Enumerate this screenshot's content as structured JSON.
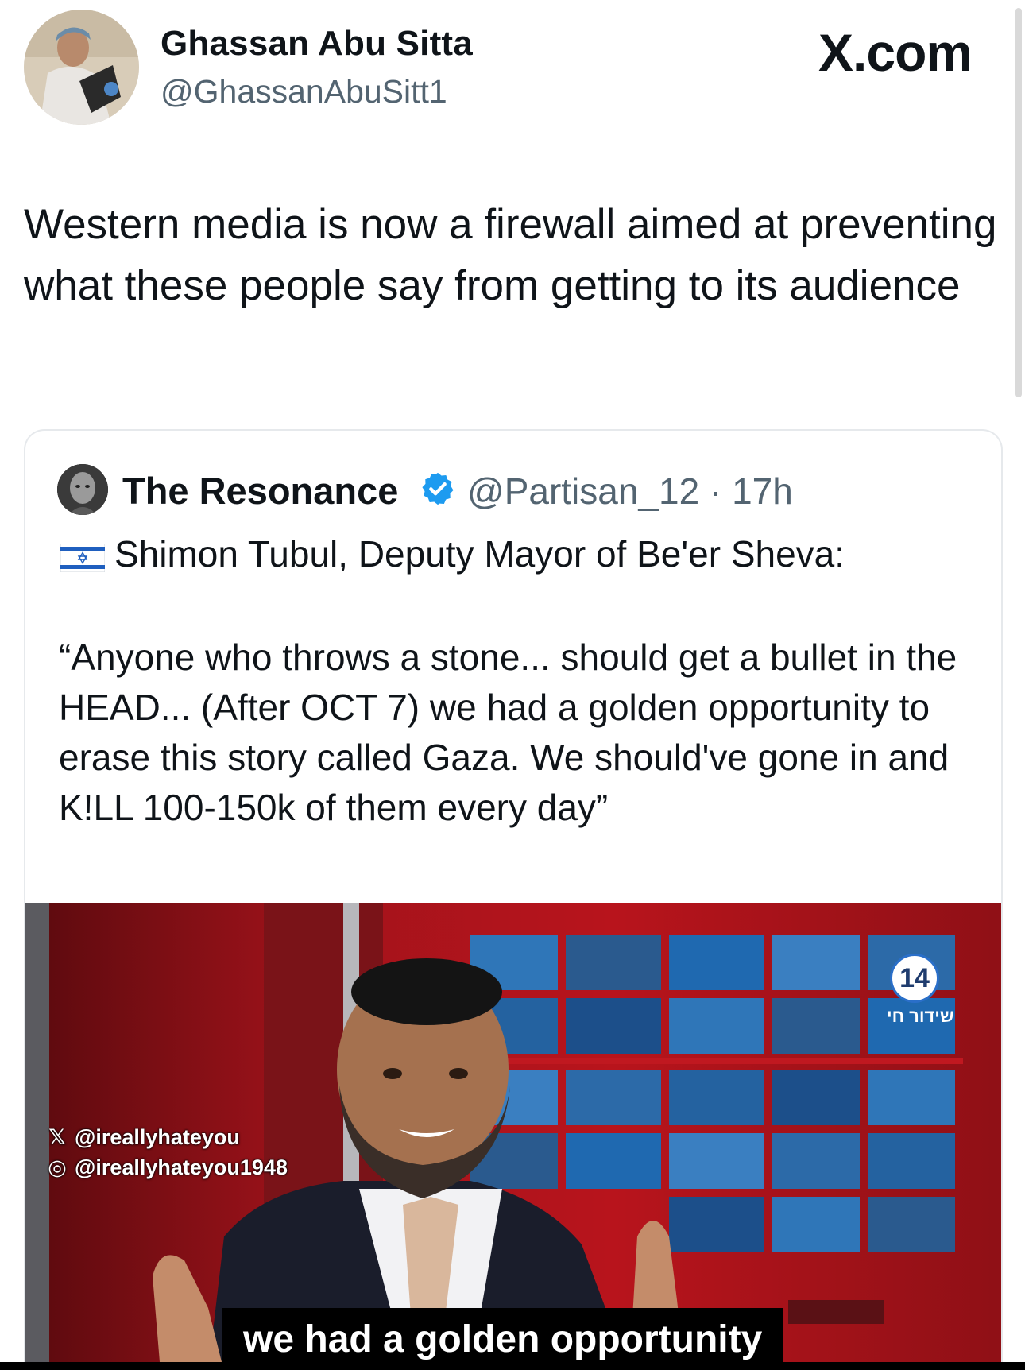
{
  "source_badge": "X.com",
  "tweet": {
    "author_name": "Ghassan Abu Sitta",
    "author_handle": "@GhassanAbuSitt1",
    "text": "Western media is now a firewall aimed at preventing what these people say from getting to its audience"
  },
  "quoted_tweet": {
    "author_name": "The Resonance",
    "verified": true,
    "handle_time": "@Partisan_12 · 17h",
    "intro": "Shimon Tubul, Deputy Mayor of Be'er Sheva:",
    "intro_flag_icon": "israel-flag-icon",
    "quote": "“Anyone who throws a stone... should get a bullet in the HEAD... (After OCT 7) we had a golden opportunity to erase this story called Gaza. We should've gone in and K!LL 100-150k of them every day”",
    "video": {
      "watermark_x": "@ireallyhateyou",
      "watermark_instagram": "@ireallyhateyou1948",
      "channel_number": "14",
      "channel_label": "שידור חי",
      "subtitle": "we had a golden opportunity"
    }
  },
  "colors": {
    "text": "#0f1419",
    "secondary": "#536471",
    "verified": "#1d9bf0",
    "border": "#e6e9ec"
  }
}
